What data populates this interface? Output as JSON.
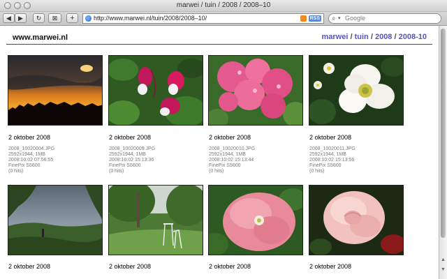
{
  "window": {
    "title": "marwei / tuin / 2008 / 2008–10"
  },
  "toolbar": {
    "url": "http://www.marwei.nl/tuin/2008/2008–10/",
    "rss_label": "RSS",
    "search_placeholder": "Google"
  },
  "page": {
    "site_name": "www.marwei.nl",
    "breadcrumb": [
      "marwei",
      "tuin",
      "2008",
      "2008-10"
    ],
    "separator": "/"
  },
  "photos": [
    {
      "caption": "2 oktober 2008",
      "filename": "2008_10020004.JPG",
      "dimensions": "2592x1944, 1MB",
      "datetime": "2008:10:02 07:56:55",
      "camera": "FinePix S5600",
      "hits": "(0 hits)"
    },
    {
      "caption": "2 oktober 2008",
      "filename": "2008_10020009.JPG",
      "dimensions": "2592x1944, 1MB",
      "datetime": "2008:10:02 15:13:36",
      "camera": "FinePix S5600",
      "hits": "(0 hits)"
    },
    {
      "caption": "2 oktober 2008",
      "filename": "2008_10020010.JPG",
      "dimensions": "2592x1944, 1MB",
      "datetime": "2008:10:02 15:13:44",
      "camera": "FinePix S5600",
      "hits": "(0 hits)"
    },
    {
      "caption": "2 oktober 2008",
      "filename": "2008_10020011.JPG",
      "dimensions": "2592x1944, 1MB",
      "datetime": "2008:10:02 15:13:56",
      "camera": "FinePix S5600",
      "hits": "(0 hits)"
    },
    {
      "caption": "2 oktober 2008"
    },
    {
      "caption": "2 oktober 2008"
    },
    {
      "caption": "2 oktober 2008"
    },
    {
      "caption": "2 oktober 2008"
    }
  ]
}
